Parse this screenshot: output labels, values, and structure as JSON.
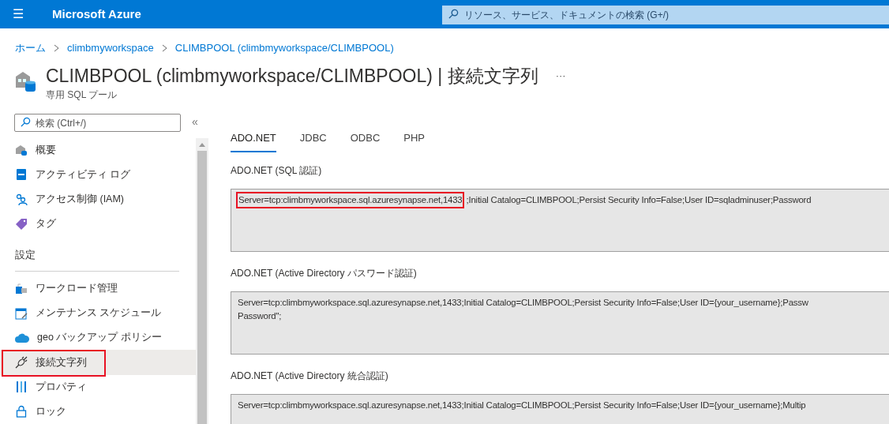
{
  "header": {
    "menu_glyph": "☰",
    "brand": "Microsoft Azure",
    "search_placeholder": "リソース、サービス、ドキュメントの検索 (G+/)"
  },
  "breadcrumb": [
    "ホーム",
    "climbmyworkspace",
    "CLIMBPOOL (climbmyworkspace/CLIMBPOOL)"
  ],
  "page": {
    "title": "CLIMBPOOL (climbmyworkspace/CLIMBPOOL) | 接続文字列",
    "subtitle": "専用 SQL プール",
    "more": "···"
  },
  "sidebar": {
    "search_placeholder": "検索 (Ctrl+/)",
    "collapse": "«",
    "items": [
      {
        "kind": "item",
        "label": "概要",
        "selected": false,
        "highlighted": false
      },
      {
        "kind": "item",
        "label": "アクティビティ ログ",
        "selected": false,
        "highlighted": false
      },
      {
        "kind": "item",
        "label": "アクセス制御 (IAM)",
        "selected": false,
        "highlighted": false
      },
      {
        "kind": "item",
        "label": "タグ",
        "selected": false,
        "highlighted": false
      },
      {
        "kind": "section",
        "label": "設定"
      },
      {
        "kind": "item",
        "label": "ワークロード管理",
        "selected": false,
        "highlighted": false
      },
      {
        "kind": "item",
        "label": "メンテナンス スケジュール",
        "selected": false,
        "highlighted": false
      },
      {
        "kind": "item",
        "label": "geo バックアップ ポリシー",
        "selected": false,
        "highlighted": false
      },
      {
        "kind": "item",
        "label": "接続文字列",
        "selected": true,
        "highlighted": true
      },
      {
        "kind": "item",
        "label": "プロパティ",
        "selected": false,
        "highlighted": false
      },
      {
        "kind": "item",
        "label": "ロック",
        "selected": false,
        "highlighted": false
      }
    ]
  },
  "tabs": [
    {
      "label": "ADO.NET",
      "selected": true
    },
    {
      "label": "JDBC",
      "selected": false
    },
    {
      "label": "ODBC",
      "selected": false
    },
    {
      "label": "PHP",
      "selected": false
    }
  ],
  "connection_strings": [
    {
      "label": "ADO.NET (SQL 認証)",
      "lines": [
        [
          {
            "text": "Server=tcp:climbmyworkspace.sql.azuresynapse.net,1433",
            "highlighted": true
          },
          {
            "text": ";Initial Catalog=CLIMBPOOL;Persist Security Info=False;User ID=sqladminuser;Password",
            "highlighted": false
          }
        ]
      ]
    },
    {
      "label": "ADO.NET (Active Directory パスワード認証)",
      "lines": [
        [
          {
            "text": "Server=tcp:climbmyworkspace.sql.azuresynapse.net,1433;Initial Catalog=CLIMBPOOL;Persist Security Info=False;User ID={your_username};Passw",
            "highlighted": false
          }
        ],
        [
          {
            "text": "Password\";",
            "highlighted": false
          }
        ]
      ]
    },
    {
      "label": "ADO.NET (Active Directory 統合認証)",
      "lines": [
        [
          {
            "text": "Server=tcp:climbmyworkspace.sql.azuresynapse.net,1433;Initial Catalog=CLIMBPOOL;Persist Security Info=False;User ID={your_username};Multip",
            "highlighted": false
          }
        ]
      ]
    }
  ]
}
